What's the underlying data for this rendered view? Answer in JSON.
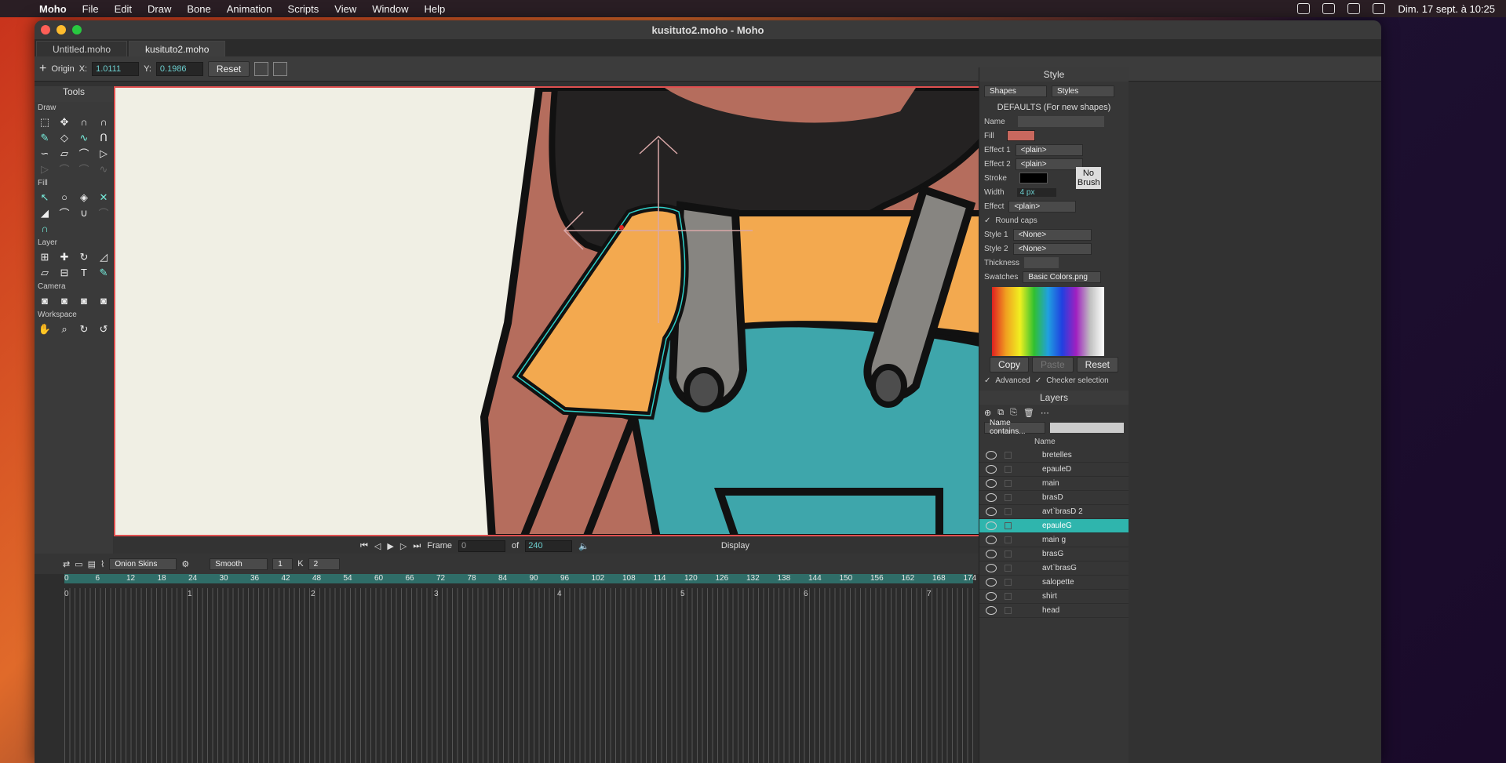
{
  "menubar": {
    "app": "Moho",
    "items": [
      "File",
      "Edit",
      "Draw",
      "Bone",
      "Animation",
      "Scripts",
      "View",
      "Window",
      "Help"
    ],
    "clock": "Dim. 17 sept. à 10:25"
  },
  "window": {
    "title": "kusituto2.moho - Moho",
    "tabs": [
      "Untitled.moho",
      "kusituto2.moho"
    ]
  },
  "toolopts": {
    "label": "Origin",
    "x_label": "X:",
    "x_value": "1.0111",
    "y_label": "Y:",
    "y_value": "0.1986",
    "reset": "Reset"
  },
  "tools": {
    "title": "Tools",
    "sections": [
      "Draw",
      "Fill",
      "Layer",
      "Camera",
      "Workspace"
    ]
  },
  "timeline": {
    "frame_label": "Frame",
    "frame": "0",
    "of_label": "of",
    "total": "240",
    "display": "Display",
    "onion": "Onion Skins",
    "interp": "Smooth",
    "interp_n": "1",
    "step": "2",
    "ruler": [
      "0",
      "6",
      "12",
      "18",
      "24",
      "30",
      "36",
      "42",
      "48",
      "54",
      "60",
      "66",
      "72",
      "78",
      "84",
      "90",
      "96",
      "102",
      "108",
      "114",
      "120",
      "126",
      "132",
      "138",
      "144",
      "150",
      "156",
      "162",
      "168",
      "174"
    ],
    "seconds": [
      "0",
      "1",
      "2",
      "3",
      "4",
      "5",
      "6",
      "7"
    ]
  },
  "style": {
    "title": "Style",
    "shapes": "Shapes",
    "styles": "Styles",
    "defaults": "DEFAULTS (For new shapes)",
    "name": "Name",
    "fill": "Fill",
    "effect1": "Effect 1",
    "effect2": "Effect 2",
    "plain": "<plain>",
    "stroke": "Stroke",
    "width": "Width",
    "width_val": "4 px",
    "effect": "Effect",
    "no_brush": "No Brush",
    "round_caps": "Round caps",
    "style1": "Style 1",
    "style2": "Style 2",
    "none": "<None>",
    "thickness": "Thickness",
    "swatches": "Swatches",
    "swatch_file": "Basic Colors.png",
    "copy": "Copy",
    "paste": "Paste",
    "reset": "Reset",
    "advanced": "Advanced",
    "checker": "Checker selection",
    "fill_color": "#c8685e",
    "stroke_color": "#000000"
  },
  "layers": {
    "title": "Layers",
    "filter": "Name contains...",
    "col_name": "Name",
    "items": [
      "bretelles",
      "epauleD",
      "main",
      "brasD",
      "avt`brasD 2",
      "epauleG",
      "main g",
      "brasG",
      "avt`brasG",
      "salopette",
      "shirt",
      "head"
    ]
  }
}
